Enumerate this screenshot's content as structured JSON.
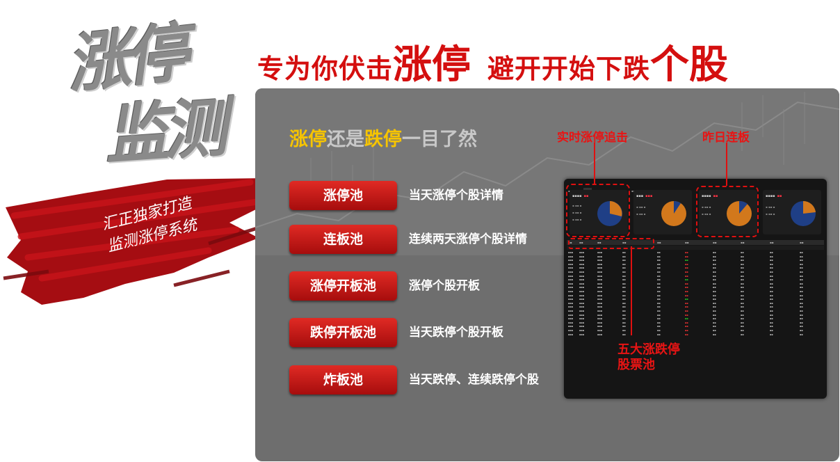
{
  "branding": {
    "callig_line1": "涨停",
    "callig_line2": "监测",
    "brush_line1": "汇正独家打造",
    "brush_line2": "监测涨停系统"
  },
  "headline": {
    "part1": "专为你伏击",
    "part2": "涨停",
    "part3": "避开开始下跌",
    "part4": "个股"
  },
  "subtitle": {
    "a": "涨停",
    "b": "还是",
    "c": "跌停",
    "d": "一目了然"
  },
  "pools": [
    {
      "label": "涨停池",
      "desc": "当天涨停个股详情"
    },
    {
      "label": "连板池",
      "desc": "连续两天涨停个股详情"
    },
    {
      "label": "涨停开板池",
      "desc": "涨停个股开板"
    },
    {
      "label": "跌停开板池",
      "desc": "当天跌停个股开板"
    },
    {
      "label": "炸板池",
      "desc": "当天跌停、连续跌停个股"
    }
  ],
  "callouts": {
    "realtime": "实时涨停追击",
    "yesterday": "昨日连板",
    "five_pools_1": "五大涨跌停",
    "five_pools_2": "股票池"
  },
  "colors": {
    "brand_red": "#d40f0f",
    "panel_grey": "#6e6e6e",
    "highlight_yellow": "#f6c400",
    "pie_blue": "#1f3f86",
    "pie_orange": "#d2781c"
  },
  "icons": [
    "pie-chart-icon"
  ]
}
